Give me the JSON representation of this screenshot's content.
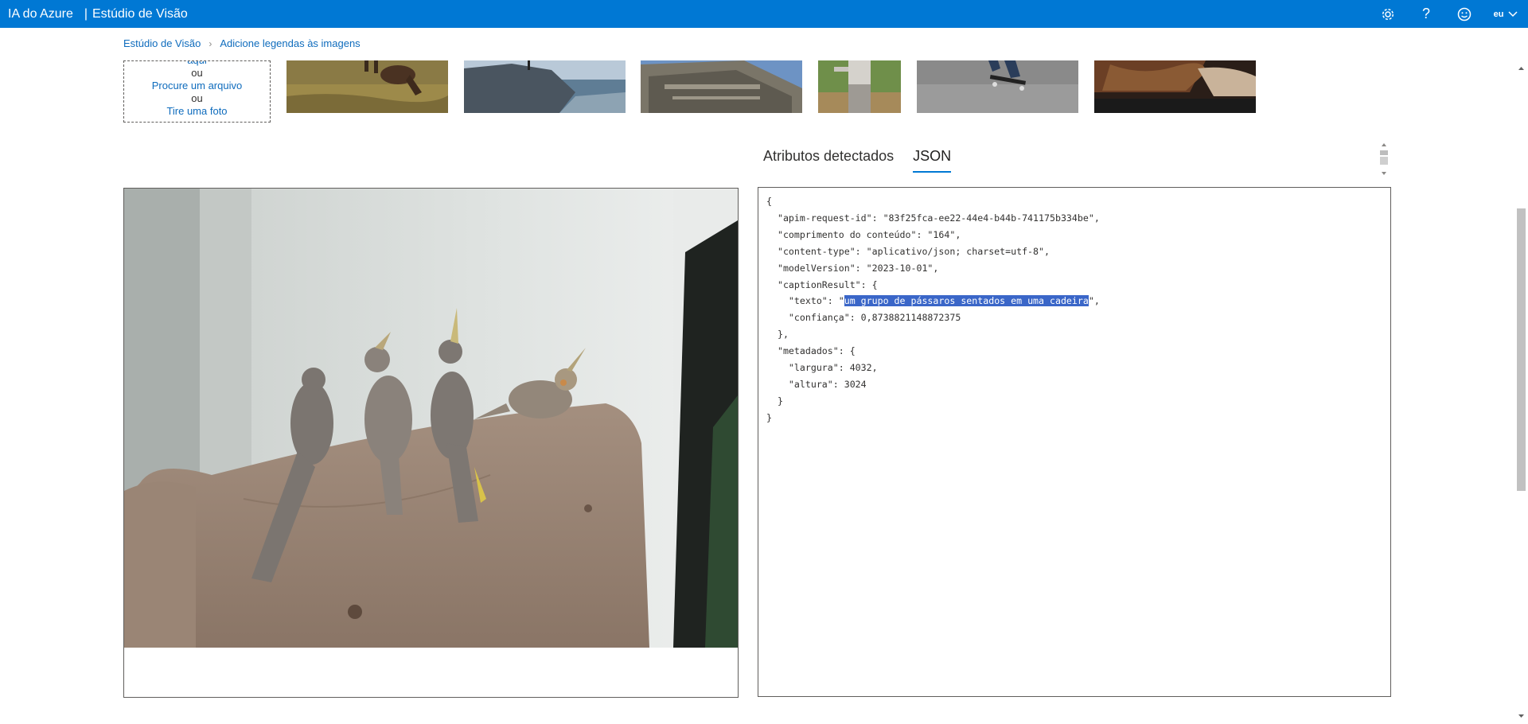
{
  "header": {
    "brand": "IA do Azure",
    "separator": "|",
    "product": "Estúdio de Visão",
    "icons": [
      "gear-icon",
      "help-icon",
      "smiley-icon",
      "chevron-down-icon"
    ],
    "user_label": "eu"
  },
  "breadcrumb": {
    "items": [
      "Estúdio de Visão",
      "Adicione legendas às imagens"
    ],
    "separator": "›"
  },
  "upload": {
    "partial_text": "aqui",
    "or1": "ou",
    "browse_link": "Procure um arquivo",
    "or2": "ou",
    "photo_link": "Tire uma foto"
  },
  "samples": [
    "sample-image-horse",
    "sample-image-rock-coast",
    "sample-image-building",
    "sample-image-baseball",
    "sample-image-skateboard",
    "sample-image-food"
  ],
  "tabs": [
    {
      "label": "Atributos detectados",
      "active": false
    },
    {
      "label": "JSON",
      "active": true
    }
  ],
  "json_output": {
    "lines": [
      "{",
      "  \"apim-request-id\": \"83f25fca-ee22-44e4-b44b-741175b334be\",",
      "  \"comprimento do conteúdo\": \"164\",",
      "  \"content-type\": \"aplicativo/json; charset=utf-8\",",
      "  \"modelVersion\": \"2023-10-01\",",
      "  \"captionResult\": {"
    ],
    "texto_prefix": "    \"texto\": \"",
    "texto_value": "um grupo de pássaros sentados em uma cadeira",
    "texto_suffix": "\",",
    "lines_after": [
      "    \"confiança\": 0,8738821148872375",
      "  },",
      "  \"metadados\": {",
      "    \"largura\": 4032,",
      "    \"altura\": 3024",
      "  }",
      "}"
    ]
  },
  "colors": {
    "accent": "#0078d4",
    "link": "#0f6cbd",
    "selection": "#3a66c8"
  }
}
